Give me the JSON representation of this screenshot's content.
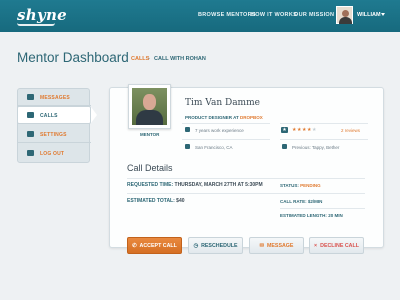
{
  "header": {
    "logo": "shyne",
    "nav": [
      "BROWSE MENTORS",
      "HOW IT WORKS",
      "OUR MISSION"
    ],
    "user_name": "WILLIAM"
  },
  "page": {
    "title": "Mentor Dashboard",
    "breadcrumb": [
      "CALLS",
      "CALL WITH ROHAN"
    ],
    "breadcrumb_sep": "›"
  },
  "sidebar": {
    "items": [
      {
        "label": "MESSAGES",
        "icon": "envelope-icon"
      },
      {
        "label": "CALLS",
        "icon": "phone-icon"
      },
      {
        "label": "SETTINGS",
        "icon": "gear-icon"
      },
      {
        "label": "LOG OUT",
        "icon": "logout-icon"
      }
    ],
    "active_index": 1
  },
  "mentor": {
    "role_label": "MENTOR",
    "name": "Tim Van Damme",
    "title": "PRODUCT DESIGNER AT",
    "company": "DROPBOX",
    "experience": "7 years work experience",
    "location": "San Francisco, CA",
    "previous": "Previous: Tappy, Bether",
    "rating": 4,
    "rating_max": 5,
    "reviews": "2 reviews"
  },
  "call": {
    "heading": "Call Details",
    "requested_label": "REQUESTED TIME:",
    "requested_value": "THURSDAY, MARCH 27TH AT 5:30PM",
    "total_label": "ESTIMATED TOTAL:",
    "total_value": "$40",
    "status_label": "STATUS:",
    "status_value": "PENDING",
    "rate_label": "CALL RATE:",
    "rate_value": "$2/MIN",
    "length_label": "ESTIMATED LENGTH:",
    "length_value": "20 MIN"
  },
  "actions": {
    "accept": "ACCEPT CALL",
    "reschedule": "RESCHEDULE",
    "message": "MESSAGE",
    "decline": "DECLINE CALL"
  },
  "colors": {
    "brand": "#1f7a90",
    "accent": "#e07a30",
    "text_teal": "#2d6775",
    "decline": "#d9534f"
  }
}
